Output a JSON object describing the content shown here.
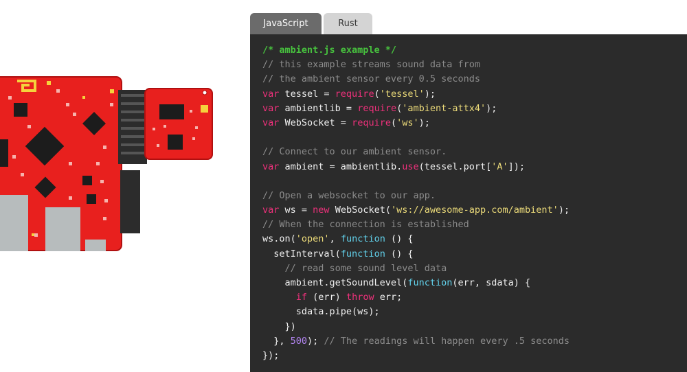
{
  "tabs": [
    {
      "label": "JavaScript",
      "active": true
    },
    {
      "label": "Rust",
      "active": false
    }
  ],
  "code": {
    "filename_comment": "/* ambient.js example */",
    "lines": [
      [
        {
          "t": "/* ambient.js example */",
          "c": "hl"
        }
      ],
      [
        {
          "t": "// this example streams sound data from",
          "c": "cm"
        }
      ],
      [
        {
          "t": "// the ambient sensor every 0.5 seconds",
          "c": "cm"
        }
      ],
      [
        {
          "t": "var",
          "c": "kw"
        },
        {
          "t": " tessel = "
        },
        {
          "t": "require",
          "c": "kw"
        },
        {
          "t": "("
        },
        {
          "t": "'tessel'",
          "c": "st"
        },
        {
          "t": ");"
        }
      ],
      [
        {
          "t": "var",
          "c": "kw"
        },
        {
          "t": " ambientlib = "
        },
        {
          "t": "require",
          "c": "kw"
        },
        {
          "t": "("
        },
        {
          "t": "'ambient-attx4'",
          "c": "st"
        },
        {
          "t": ");"
        }
      ],
      [
        {
          "t": "var",
          "c": "kw"
        },
        {
          "t": " WebSocket = "
        },
        {
          "t": "require",
          "c": "kw"
        },
        {
          "t": "("
        },
        {
          "t": "'ws'",
          "c": "st"
        },
        {
          "t": ");"
        }
      ],
      [],
      [
        {
          "t": "// Connect to our ambient sensor.",
          "c": "cm"
        }
      ],
      [
        {
          "t": "var",
          "c": "kw"
        },
        {
          "t": " ambient = ambientlib."
        },
        {
          "t": "use",
          "c": "kw"
        },
        {
          "t": "(tessel.port["
        },
        {
          "t": "'A'",
          "c": "st"
        },
        {
          "t": "]);"
        }
      ],
      [],
      [
        {
          "t": "// Open a websocket to our app.",
          "c": "cm"
        }
      ],
      [
        {
          "t": "var",
          "c": "kw"
        },
        {
          "t": " ws = "
        },
        {
          "t": "new",
          "c": "kw"
        },
        {
          "t": " WebSocket("
        },
        {
          "t": "'ws://awesome-app.com/ambient'",
          "c": "st"
        },
        {
          "t": ");"
        }
      ],
      [
        {
          "t": "// When the connection is established",
          "c": "cm"
        }
      ],
      [
        {
          "t": "ws.on("
        },
        {
          "t": "'open'",
          "c": "st"
        },
        {
          "t": ", "
        },
        {
          "t": "function",
          "c": "fn"
        },
        {
          "t": " () {"
        }
      ],
      [
        {
          "t": "  setInterval("
        },
        {
          "t": "function",
          "c": "fn"
        },
        {
          "t": " () {"
        }
      ],
      [
        {
          "t": "    "
        },
        {
          "t": "// read some sound level data",
          "c": "cm"
        }
      ],
      [
        {
          "t": "    ambient.getSoundLevel("
        },
        {
          "t": "function",
          "c": "fn"
        },
        {
          "t": "(err, sdata) {"
        }
      ],
      [
        {
          "t": "      "
        },
        {
          "t": "if",
          "c": "kw"
        },
        {
          "t": " (err) "
        },
        {
          "t": "throw",
          "c": "kw"
        },
        {
          "t": " err;"
        }
      ],
      [
        {
          "t": "      sdata.pipe(ws);"
        }
      ],
      [
        {
          "t": "    })"
        }
      ],
      [
        {
          "t": "  }, "
        },
        {
          "t": "500",
          "c": "nm"
        },
        {
          "t": "); "
        },
        {
          "t": "// The readings will happen every .5 seconds",
          "c": "cm"
        }
      ],
      [
        {
          "t": "});"
        }
      ]
    ]
  },
  "colors": {
    "code_background": "#2b2b2b",
    "keyword": "#f0317c",
    "function": "#62d2ec",
    "string": "#eddc7a",
    "number": "#b385f2",
    "comment": "#8c8c8c",
    "header_comment": "#47c13e",
    "board_red": "#e8201e"
  },
  "illustration": {
    "name": "tessel-board-with-ambient-module-icon"
  }
}
